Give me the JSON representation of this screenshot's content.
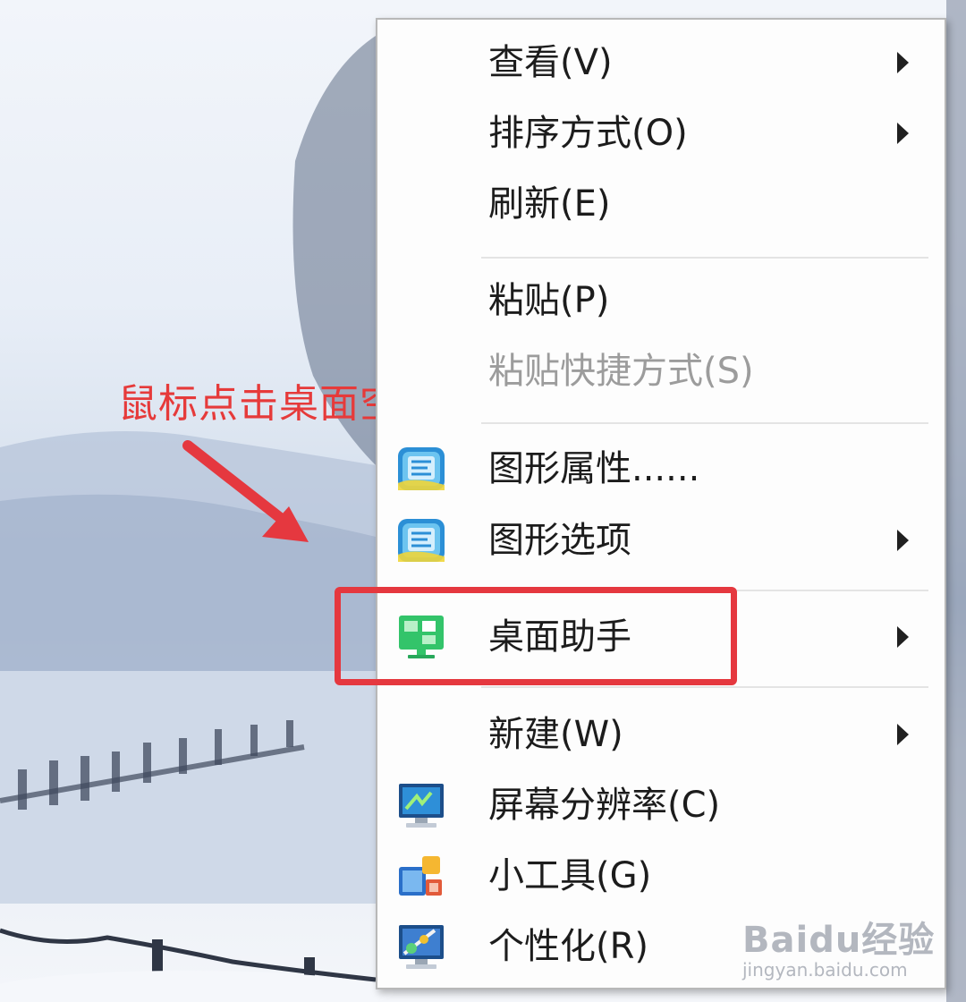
{
  "annotation": {
    "text": "鼠标点击桌面空白处",
    "color": "#e63a3a"
  },
  "context_menu": {
    "items": [
      {
        "label": "查看(V)",
        "submenu": true,
        "enabled": true
      },
      {
        "label": "排序方式(O)",
        "submenu": true,
        "enabled": true
      },
      {
        "label": "刷新(E)",
        "submenu": false,
        "enabled": true
      },
      {
        "label": "粘贴(P)",
        "submenu": false,
        "enabled": true
      },
      {
        "label": "粘贴快捷方式(S)",
        "submenu": false,
        "enabled": false
      },
      {
        "label": "图形属性......",
        "icon": "intel-graphics-icon",
        "submenu": false,
        "enabled": true
      },
      {
        "label": "图形选项",
        "icon": "intel-graphics-icon",
        "submenu": true,
        "enabled": true
      },
      {
        "label": "桌面助手",
        "icon": "desktop-assistant-icon",
        "submenu": true,
        "enabled": true,
        "highlighted": true
      },
      {
        "label": "新建(W)",
        "submenu": true,
        "enabled": true
      },
      {
        "label": "屏幕分辨率(C)",
        "icon": "screen-resolution-icon",
        "submenu": false,
        "enabled": true
      },
      {
        "label": "小工具(G)",
        "icon": "gadgets-icon",
        "submenu": false,
        "enabled": true
      },
      {
        "label": "个性化(R)",
        "icon": "personalize-icon",
        "submenu": false,
        "enabled": true
      }
    ]
  },
  "highlight_color": "#e5383f",
  "watermark": {
    "brand": "Baidu经验",
    "url": "jingyan.baidu.com"
  }
}
